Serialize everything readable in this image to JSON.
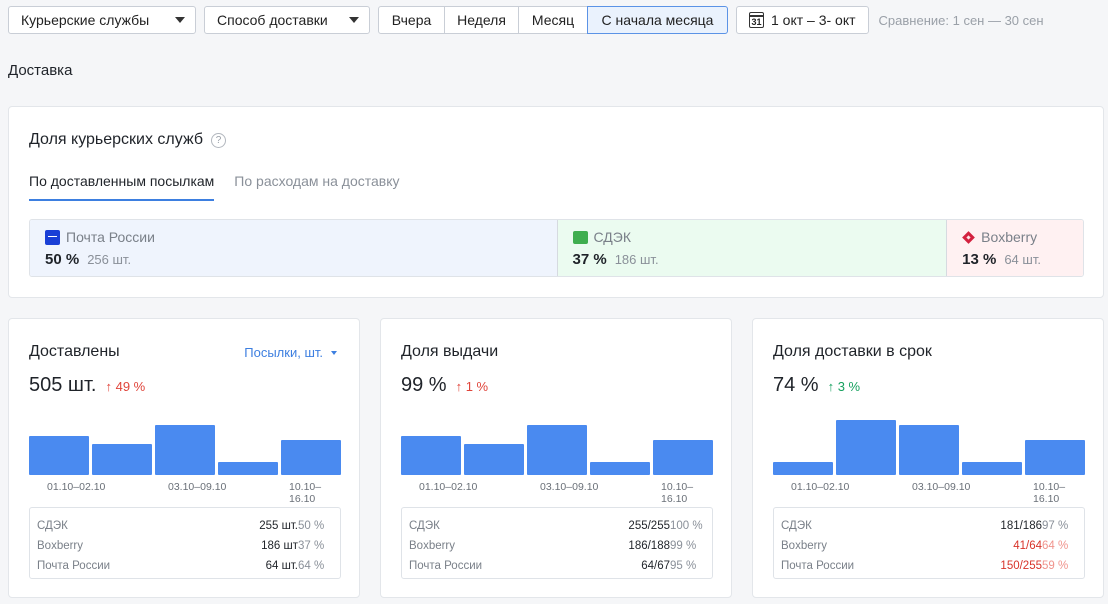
{
  "toolbar": {
    "couriers_dropdown": "Курьерские службы",
    "delivery_method_dropdown": "Способ доставки",
    "periods": [
      "Вчера",
      "Неделя",
      "Месяц",
      "С начала месяца"
    ],
    "active_period": "С начала месяца",
    "date_icon_text": "31",
    "date_range": "1 окт – 3- окт",
    "comparison": "Сравнение: 1 сен — 30 сен"
  },
  "section_title": "Доставка",
  "share": {
    "title": "Доля курьерских служб",
    "help_glyph": "?",
    "tabs": [
      "По доставленным посылкам",
      "По расходам на доставку"
    ],
    "active_tab": "По доставленным посылкам",
    "segments": [
      {
        "name": "Почта России",
        "percent": "50 %",
        "count": "256 шт.",
        "share": 50,
        "bg": "#eff4fd",
        "icon": "pochta-rossii-logo-icon"
      },
      {
        "name": "СДЭК",
        "percent": "37 %",
        "count": "186 шт.",
        "share": 37,
        "bg": "#ebfbf0",
        "icon": "cdek-logo-icon"
      },
      {
        "name": "Boxberry",
        "percent": "13 %",
        "count": "64 шт.",
        "share": 13,
        "bg": "#fff1f2",
        "icon": "boxberry-logo-icon"
      }
    ]
  },
  "cards": [
    {
      "title": "Доставлены",
      "selector": "Посылки, шт.",
      "value": "505 шт.",
      "delta": "↑ 49 %",
      "delta_color": "red",
      "chart_data": {
        "type": "bar",
        "categories": [
          "01.10–02.10",
          "",
          "03.10–09.10",
          "",
          "10.10–16.10"
        ],
        "values": [
          35,
          28,
          45,
          12,
          31
        ],
        "ylim": [
          0,
          50
        ]
      },
      "x_labels": [
        "01.10–02.10",
        "03.10–09.10",
        "10.10–16.10"
      ],
      "rows": [
        {
          "name": "СДЭК",
          "v1": "255 шт.",
          "v2": "50 %",
          "bad": false
        },
        {
          "name": "Boxberry",
          "v1": "186 шт",
          "v2": "37 %",
          "bad": false
        },
        {
          "name": "Почта России",
          "v1": "64 шт.",
          "v2": "64 %",
          "bad": false
        }
      ]
    },
    {
      "title": "Доля выдачи",
      "value": "99 %",
      "delta": "↑ 1 %",
      "delta_color": "red",
      "chart_data": {
        "type": "bar",
        "categories": [
          "01.10–02.10",
          "",
          "03.10–09.10",
          "",
          "10.10–16.10"
        ],
        "values": [
          35,
          28,
          45,
          12,
          31
        ],
        "ylim": [
          0,
          50
        ]
      },
      "x_labels": [
        "01.10–02.10",
        "03.10–09.10",
        "10.10–16.10"
      ],
      "rows": [
        {
          "name": "СДЭК",
          "v1": "255/255",
          "v2": "100 %",
          "bad": false
        },
        {
          "name": "Boxberry",
          "v1": "186/188",
          "v2": "99 %",
          "bad": false
        },
        {
          "name": "Почта России",
          "v1": "64/67",
          "v2": "95 %",
          "bad": false
        }
      ]
    },
    {
      "title": "Доля доставки в срок",
      "value": "74 %",
      "delta": "↑ 3 %",
      "delta_color": "green",
      "chart_data": {
        "type": "bar",
        "categories": [
          "01.10–02.10",
          "",
          "03.10–09.10",
          "",
          "10.10–16.10"
        ],
        "values": [
          12,
          49,
          45,
          12,
          31
        ],
        "ylim": [
          0,
          50
        ]
      },
      "x_labels": [
        "01.10–02.10",
        "03.10–09.10",
        "10.10–16.10"
      ],
      "rows": [
        {
          "name": "СДЭК",
          "v1": "181/186",
          "v2": "97 %",
          "bad": false
        },
        {
          "name": "Boxberry",
          "v1": "41/64",
          "v2": "64 %",
          "bad": true
        },
        {
          "name": "Почта России",
          "v1": "150/255",
          "v2": "59 %",
          "bad": true
        }
      ]
    }
  ]
}
